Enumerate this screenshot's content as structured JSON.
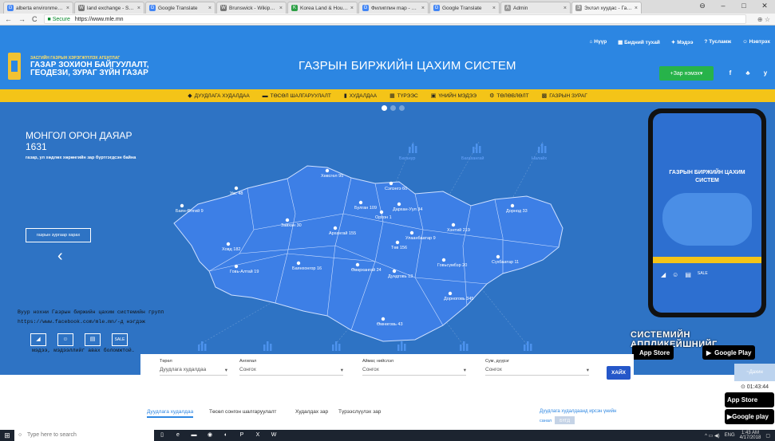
{
  "browser": {
    "tabs": [
      {
        "title": "alberta environment ai",
        "icon": "G",
        "color": "#4285f4"
      },
      {
        "title": "land exchange - Search",
        "icon": "W",
        "color": "#777777"
      },
      {
        "title": "Google Translate",
        "icon": "G",
        "color": "#4285f4"
      },
      {
        "title": "Brunswick - Wikipedia",
        "icon": "W",
        "color": "#777777"
      },
      {
        "title": "Korea Land & Housing",
        "icon": "K",
        "color": "#2c9f45"
      },
      {
        "title": "Филиппин map - Goo",
        "icon": "G",
        "color": "#4285f4"
      },
      {
        "title": "Google Translate",
        "icon": "G",
        "color": "#4285f4"
      },
      {
        "title": "Admin",
        "icon": "A",
        "color": "#999999"
      },
      {
        "title": "Эхлэл хуудас - Газры",
        "icon": "Э",
        "color": "#999999"
      }
    ],
    "secure_label": "Secure",
    "url": "https://www.mle.mn"
  },
  "header": {
    "toplinks": [
      "Нүүр",
      "Бидний тухай",
      "Мэдээ",
      "Тусламж",
      "Нэвтрэх"
    ],
    "org_line1": "ЗАСГИЙН ГАЗРЫН ХЭРЭГЖҮҮЛЭХ АГЕНТЛАГ",
    "org_line2": "ГАЗАР ЗОХИОН БАЙГУУЛАЛТ,",
    "org_line3": "ГЕОДЕЗИ, ЗУРАГ ЗҮЙН ГАЗАР",
    "system_title": "ГАЗРЫН БИРЖИЙН ЦАХИМ СИСТЕМ",
    "ad_button": "Зар нэмэх",
    "social": [
      "f",
      "♣",
      "y"
    ]
  },
  "menu": [
    {
      "icon": "◆",
      "label": "ДУУДЛАГА ХУДАЛДАА"
    },
    {
      "icon": "▬",
      "label": "ТӨСӨЛ ШАЛГАРУУЛАЛТ"
    },
    {
      "icon": "▮",
      "label": "ХУДАЛДАА"
    },
    {
      "icon": "▦",
      "label": "ТҮРЭЭС"
    },
    {
      "icon": "▣",
      "label": "ҮНИЙН МЭДЭЭ"
    },
    {
      "icon": "⚙",
      "label": "ТӨЛӨВЛӨЛТ"
    },
    {
      "icon": "▩",
      "label": "ГАЗРЫН ЗУРАГ"
    }
  ],
  "hero": {
    "title_line1": "МОНГОЛ ОРОН ДАЯАР",
    "title_line2": "1631",
    "subtitle": "газар, ул хөдлөх хөрөнгийн зар бүртгэгдсэн байна",
    "map_button": "газрын зургаар харах",
    "facebook_text_1": "Вуур нохни Газрын биржийн цахим системийн групп",
    "facebook_text_2": "https://www.facebook.com/mle.mn/-д нэгдэж",
    "facebook_text_3": "мэдээ, мэдээллийг авах боломжтой.",
    "sale_label": "SALE",
    "mini_labels": [
      "ДУУДЛАГА",
      "ТӨСӨЛ",
      "ХУДАЛДАА",
      "ТҮРЭЭС"
    ],
    "chart_labels": [
      "Баганур",
      "Багахангай",
      "Налайх"
    ],
    "phone_title": "ГАЗРЫН БИРЖИЙН ЦАХИМ СИСТЕМ",
    "sysapp": "СИСТЕМИЙН АППЛИКЕЙШНИЙГ",
    "appstore": "App Store",
    "playstore": "Google Play"
  },
  "regions": [
    {
      "name": "Увс",
      "count": 48
    },
    {
      "name": "Хөвсгөл",
      "count": 95
    },
    {
      "name": "Сэлэнгэ",
      "count": 60
    },
    {
      "name": "Баян-Өлгий",
      "count": 9
    },
    {
      "name": "Завхан",
      "count": 30
    },
    {
      "name": "Булган",
      "count": 109
    },
    {
      "name": "Дархан-Уул",
      "count": 34
    },
    {
      "name": "Орхон",
      "count": 1
    },
    {
      "name": "Дорнод",
      "count": 33
    },
    {
      "name": "Архангай",
      "count": 155
    },
    {
      "name": "Хэнтий",
      "count": 219
    },
    {
      "name": "Улаанбаатар",
      "count": 9
    },
    {
      "name": "Төв",
      "count": 156
    },
    {
      "name": "Ховд",
      "count": 182
    },
    {
      "name": "Сүхбаатар",
      "count": 11
    },
    {
      "name": "Говь-Алтай",
      "count": 19
    },
    {
      "name": "Баянхонгор",
      "count": 16
    },
    {
      "name": "Өвөрхангай",
      "count": 24
    },
    {
      "name": "Говьсүмбэр",
      "count": 20
    },
    {
      "name": "Дундговь",
      "count": 13
    },
    {
      "name": "Дорноговь",
      "count": 345
    },
    {
      "name": "Өмнөговь",
      "count": 43
    }
  ],
  "search": {
    "type_label": "Төрөл",
    "type_value": "Дуудлага худалдаа",
    "category_label": "Ангилал",
    "category_value": "Сонгох",
    "aimag_label": "Аймаг, нийслэл",
    "aimag_value": "Сонгох",
    "sum_label": "Сум, дүүрэг",
    "sum_value": "Сонгох",
    "button": "ХАЙХ"
  },
  "timer": {
    "label": "~Дахин",
    "value": "01:43:44"
  },
  "lower_tabs": [
    "Дуудлага худалдаа",
    "Төсөл сонгон шалгаруулалт",
    "Худалдах зар",
    "Түрээслүүлэх зар"
  ],
  "note": {
    "text1": "Дуудлага худалдаанд ирсэн үнийн",
    "text2": "санал",
    "badge": "БҮГД"
  },
  "badges": {
    "appstore": "App Store",
    "playstore": "Google play"
  },
  "taskbar": {
    "search_placeholder": "Type here to search",
    "lang": "ENG",
    "time": "1:43 AM",
    "date": "4/17/2018"
  }
}
